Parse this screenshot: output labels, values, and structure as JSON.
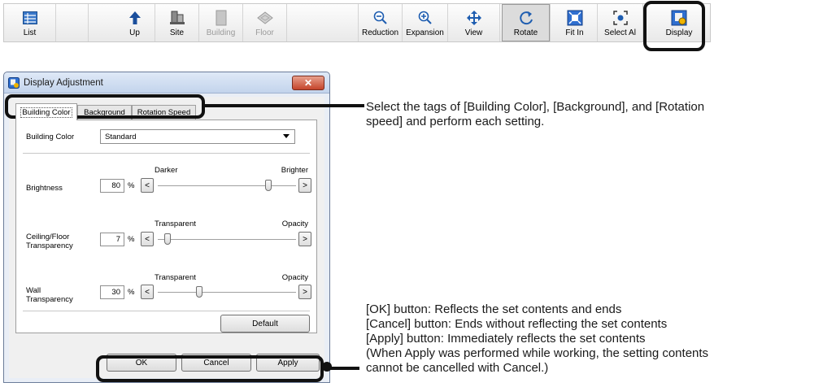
{
  "toolbar": {
    "buttons": [
      {
        "label": "List",
        "icon": "list-icon",
        "state": "normal"
      },
      {
        "label": "Up",
        "icon": "up-arrow-icon",
        "state": "normal"
      },
      {
        "label": "Site",
        "icon": "site-icon",
        "state": "normal"
      },
      {
        "label": "Building",
        "icon": "building-icon",
        "state": "disabled"
      },
      {
        "label": "Floor",
        "icon": "floor-icon",
        "state": "disabled"
      },
      {
        "label": "Reduction",
        "icon": "zoom-out-icon",
        "state": "normal"
      },
      {
        "label": "Expansion",
        "icon": "zoom-in-icon",
        "state": "normal"
      },
      {
        "label": "View",
        "icon": "view-icon",
        "state": "normal"
      },
      {
        "label": "Rotate",
        "icon": "rotate-icon",
        "state": "pressed"
      },
      {
        "label": "Fit In",
        "icon": "fit-in-icon",
        "state": "normal"
      },
      {
        "label": "Select Al",
        "icon": "select-all-icon",
        "state": "normal"
      },
      {
        "label": "Display",
        "icon": "display-icon",
        "state": "normal"
      }
    ]
  },
  "dialog": {
    "title": "Display Adjustment",
    "close_label": "✕",
    "tabs": [
      "Building Color",
      "Background",
      "Rotation Speed"
    ],
    "active_tab": "Building Color",
    "building_color": {
      "label": "Building Color",
      "value": "Standard"
    },
    "brightness": {
      "label": "Brightness",
      "value": "80",
      "unit": "%",
      "left": "Darker",
      "right": "Brighter",
      "level": 0.8
    },
    "ceiling": {
      "label": "Ceiling/Floor Transparency",
      "value": "7",
      "unit": "%",
      "left": "Transparent",
      "right": "Opacity",
      "level": 0.07
    },
    "wall": {
      "label": "Wall Transparency",
      "value": "30",
      "unit": "%",
      "left": "Transparent",
      "right": "Opacity",
      "level": 0.3
    },
    "slider_left": "<",
    "slider_right": ">",
    "default_label": "Default",
    "ok_label": "OK",
    "cancel_label": "Cancel",
    "apply_label": "Apply"
  },
  "notes": {
    "tabs_note": [
      "Select the tags of [Building Color], [Background], and [Rotation",
      "speed] and perform each setting."
    ],
    "buttons_note": [
      "[OK] button: Reflects the set contents and ends",
      "[Cancel] button: Ends without reflecting the set contents",
      "[Apply] button: Immediately reflects the set contents",
      "(When Apply was performed while working, the setting contents",
      "cannot be cancelled with Cancel.)"
    ]
  }
}
